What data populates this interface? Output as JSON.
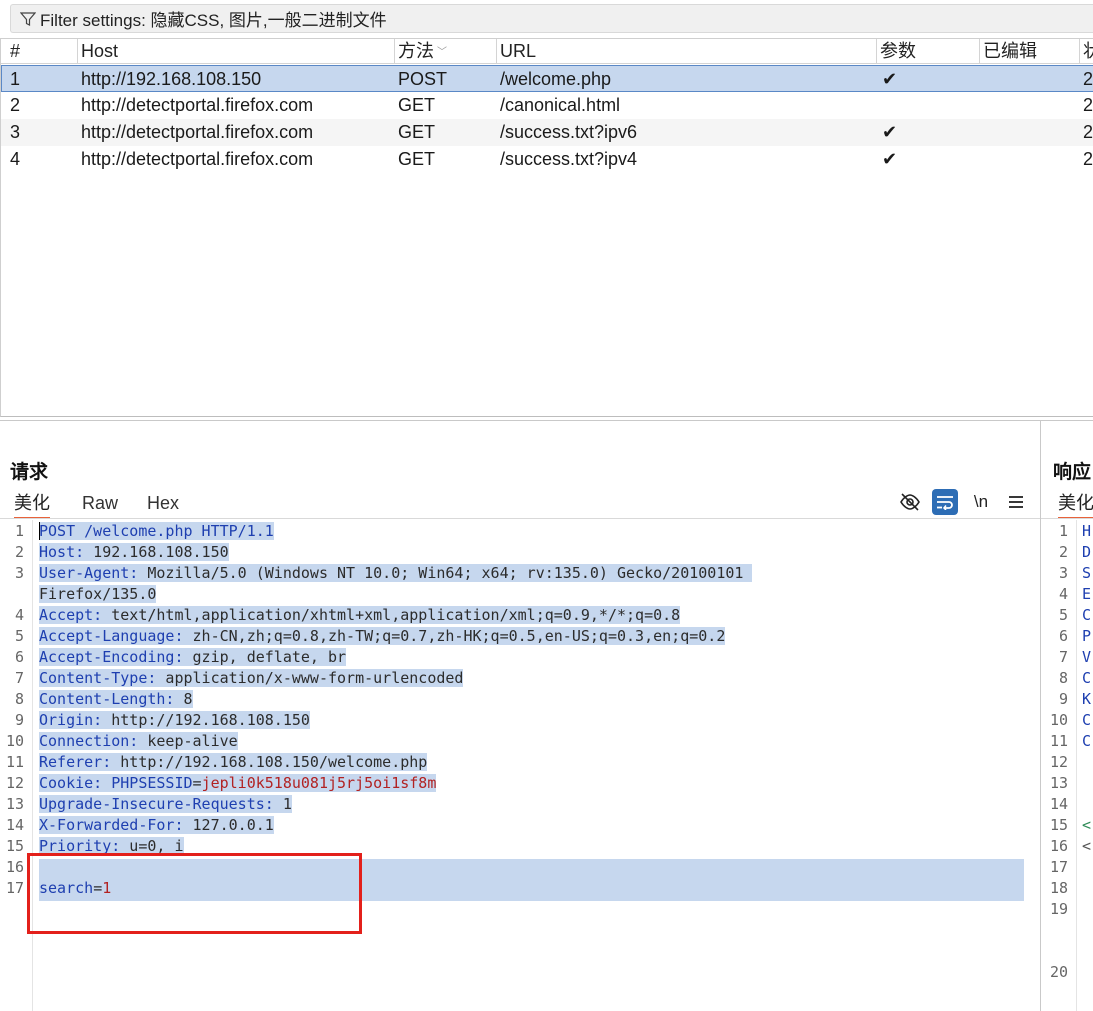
{
  "filter": {
    "label": "Filter settings: 隐藏CSS, 图片,一般二进制文件"
  },
  "table": {
    "headers": [
      "#",
      "Host",
      "方法",
      "URL",
      "参数",
      "已编辑",
      "状"
    ],
    "rows": [
      {
        "num": "1",
        "host": "http://192.168.108.150",
        "method": "POST",
        "url": "/welcome.php",
        "params": "✔",
        "edited": "",
        "status": "2"
      },
      {
        "num": "2",
        "host": "http://detectportal.firefox.com",
        "method": "GET",
        "url": "/canonical.html",
        "params": "",
        "edited": "",
        "status": "2"
      },
      {
        "num": "3",
        "host": "http://detectportal.firefox.com",
        "method": "GET",
        "url": "/success.txt?ipv6",
        "params": "✔",
        "edited": "",
        "status": "2"
      },
      {
        "num": "4",
        "host": "http://detectportal.firefox.com",
        "method": "GET",
        "url": "/success.txt?ipv4",
        "params": "✔",
        "edited": "",
        "status": "2"
      }
    ]
  },
  "request": {
    "title": "请求",
    "tabs": [
      "美化",
      "Raw",
      "Hex"
    ],
    "wrap_label": "\\n",
    "line_numbers": [
      "1",
      "2",
      "3",
      "",
      "4",
      "5",
      "6",
      "7",
      "8",
      "9",
      "10",
      "11",
      "12",
      "13",
      "14",
      "15",
      "16",
      "17"
    ],
    "lines": [
      {
        "k": "POST /welcome.php HTTP/1.1",
        "v": "",
        "r": ""
      },
      {
        "k": "Host:",
        "v": " 192.168.108.150",
        "r": ""
      },
      {
        "k": "User-Agent:",
        "v": " Mozilla/5.0 (Windows NT 10.0; Win64; x64; rv:135.0) Gecko/20100101 ",
        "r": ""
      },
      {
        "k": "",
        "v": "Firefox/135.0",
        "r": ""
      },
      {
        "k": "Accept:",
        "v": " text/html,application/xhtml+xml,application/xml;q=0.9,*/*;q=0.8",
        "r": ""
      },
      {
        "k": "Accept-Language:",
        "v": " zh-CN,zh;q=0.8,zh-TW;q=0.7,zh-HK;q=0.5,en-US;q=0.3,en;q=0.2",
        "r": ""
      },
      {
        "k": "Accept-Encoding:",
        "v": " gzip, deflate, br",
        "r": ""
      },
      {
        "k": "Content-Type:",
        "v": " application/x-www-form-urlencoded",
        "r": ""
      },
      {
        "k": "Content-Length:",
        "v": " 8",
        "r": ""
      },
      {
        "k": "Origin:",
        "v": " http://192.168.108.150",
        "r": ""
      },
      {
        "k": "Connection:",
        "v": " keep-alive",
        "r": ""
      },
      {
        "k": "Referer:",
        "v": " http://192.168.108.150/welcome.php",
        "r": ""
      },
      {
        "k": "Cookie: PHPSESSID",
        "v": "=",
        "r": "jepli0k518u081j5rj5oi1sf8m"
      },
      {
        "k": "Upgrade-Insecure-Requests:",
        "v": " 1",
        "r": ""
      },
      {
        "k": "X-Forwarded-For:",
        "v": " 127.0.0.1",
        "r": ""
      },
      {
        "k": "Priority:",
        "v": " u=0, i",
        "r": ""
      },
      {
        "k": "",
        "v": "",
        "r": ""
      },
      {
        "k": "search",
        "v": "=",
        "r": "1"
      }
    ]
  },
  "response": {
    "title": "响应",
    "tab": "美化",
    "line_numbers": [
      "1",
      "2",
      "3",
      "4",
      "5",
      "6",
      "7",
      "8",
      "9",
      "10",
      "11",
      "12",
      "13",
      "14",
      "15",
      "16",
      "17",
      "18",
      "19",
      "",
      "",
      "20"
    ],
    "chars": [
      "H",
      "D",
      "S",
      "E",
      "C",
      "P",
      "V",
      "C",
      "K",
      "C",
      "C",
      "",
      "",
      "",
      "<",
      "<",
      "",
      "",
      "",
      "",
      "",
      ""
    ]
  },
  "colors": {
    "accent": "#e8623a",
    "selection": "#c6d7ee",
    "header_key": "#1e3fb0",
    "value_red": "#b22222",
    "annotation_box": "#e3201b"
  }
}
